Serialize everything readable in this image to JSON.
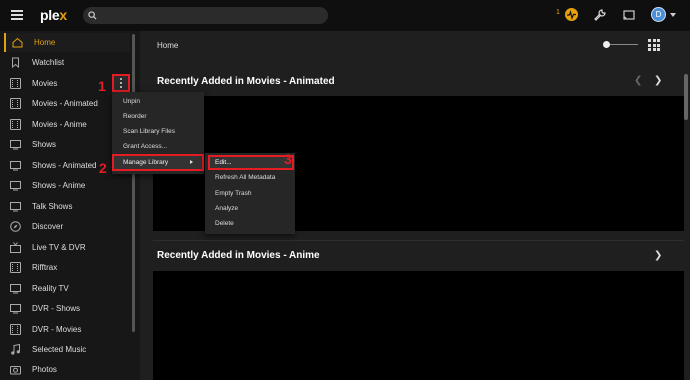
{
  "app": {
    "logo_main": "ple",
    "logo_x": "x"
  },
  "topbar": {
    "notification_count": "1",
    "user_initial": "D"
  },
  "sidebar": {
    "items": [
      {
        "label": "Home",
        "icon": "home-icon"
      },
      {
        "label": "Watchlist",
        "icon": "bookmark-icon"
      },
      {
        "label": "Movies",
        "icon": "film-icon"
      },
      {
        "label": "Movies - Animated",
        "icon": "film-icon"
      },
      {
        "label": "Movies - Anime",
        "icon": "film-icon"
      },
      {
        "label": "Shows",
        "icon": "tv-icon"
      },
      {
        "label": "Shows - Animated",
        "icon": "tv-icon"
      },
      {
        "label": "Shows - Anime",
        "icon": "tv-icon"
      },
      {
        "label": "Talk Shows",
        "icon": "tv-icon"
      },
      {
        "label": "Discover",
        "icon": "compass-icon"
      },
      {
        "label": "Live TV & DVR",
        "icon": "antenna-tv-icon"
      },
      {
        "label": "Rifftrax",
        "icon": "film-icon"
      },
      {
        "label": "Reality TV",
        "icon": "tv-icon"
      },
      {
        "label": "DVR - Shows",
        "icon": "tv-icon"
      },
      {
        "label": "DVR - Movies",
        "icon": "film-icon"
      },
      {
        "label": "Selected Music",
        "icon": "music-note-icon"
      },
      {
        "label": "Photos",
        "icon": "camera-icon"
      }
    ]
  },
  "main": {
    "page_title": "Home",
    "sections": [
      {
        "title": "Recently Added in Movies - Animated"
      },
      {
        "title": "Recently Added in Movies - Anime"
      }
    ]
  },
  "library_menu": {
    "items": [
      "Unpin",
      "Reorder",
      "Scan Library Files",
      "Grant Access..."
    ],
    "manage_label": "Manage Library"
  },
  "manage_submenu": {
    "items": [
      "Edit...",
      "Refresh All Metadata",
      "Empty Trash",
      "Analyze",
      "Delete"
    ]
  },
  "annotations": [
    "1",
    "2",
    "3"
  ],
  "colors": {
    "accent": "#e5a00d",
    "highlight": "#e51c23",
    "background": "#1f1f1f",
    "sidebar": "#171717"
  }
}
